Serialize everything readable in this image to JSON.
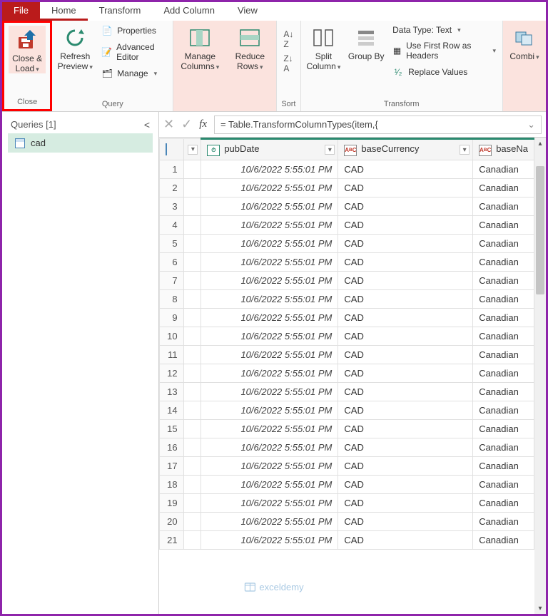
{
  "tabs": {
    "file": "File",
    "home": "Home",
    "transform": "Transform",
    "addColumn": "Add Column",
    "view": "View"
  },
  "ribbon": {
    "close": {
      "closeLoad": "Close & Load",
      "group": "Close"
    },
    "query": {
      "refresh": "Refresh Preview",
      "properties": "Properties",
      "advEditor": "Advanced Editor",
      "manage": "Manage",
      "group": "Query"
    },
    "cols": {
      "manageCols": "Manage Columns",
      "reduceRows": "Reduce Rows"
    },
    "sort": {
      "group": "Sort"
    },
    "split": "Split Column",
    "groupBy": "Group By",
    "dataType": "Data Type: Text",
    "firstRow": "Use First Row as Headers",
    "replace": "Replace Values",
    "transformGroup": "Transform",
    "combine": "Combi"
  },
  "queries": {
    "header": "Queries [1]",
    "item": "cad"
  },
  "formula": "= Table.TransformColumnTypes(item,{",
  "columns": {
    "pubDate": "pubDate",
    "baseCurrency": "baseCurrency",
    "baseName": "baseNa"
  },
  "rows": [
    {
      "n": 1,
      "d": "10/6/2022 5:55:01 PM",
      "c": "CAD",
      "b": "Canadian"
    },
    {
      "n": 2,
      "d": "10/6/2022 5:55:01 PM",
      "c": "CAD",
      "b": "Canadian"
    },
    {
      "n": 3,
      "d": "10/6/2022 5:55:01 PM",
      "c": "CAD",
      "b": "Canadian"
    },
    {
      "n": 4,
      "d": "10/6/2022 5:55:01 PM",
      "c": "CAD",
      "b": "Canadian"
    },
    {
      "n": 5,
      "d": "10/6/2022 5:55:01 PM",
      "c": "CAD",
      "b": "Canadian"
    },
    {
      "n": 6,
      "d": "10/6/2022 5:55:01 PM",
      "c": "CAD",
      "b": "Canadian"
    },
    {
      "n": 7,
      "d": "10/6/2022 5:55:01 PM",
      "c": "CAD",
      "b": "Canadian"
    },
    {
      "n": 8,
      "d": "10/6/2022 5:55:01 PM",
      "c": "CAD",
      "b": "Canadian"
    },
    {
      "n": 9,
      "d": "10/6/2022 5:55:01 PM",
      "c": "CAD",
      "b": "Canadian"
    },
    {
      "n": 10,
      "d": "10/6/2022 5:55:01 PM",
      "c": "CAD",
      "b": "Canadian"
    },
    {
      "n": 11,
      "d": "10/6/2022 5:55:01 PM",
      "c": "CAD",
      "b": "Canadian"
    },
    {
      "n": 12,
      "d": "10/6/2022 5:55:01 PM",
      "c": "CAD",
      "b": "Canadian"
    },
    {
      "n": 13,
      "d": "10/6/2022 5:55:01 PM",
      "c": "CAD",
      "b": "Canadian"
    },
    {
      "n": 14,
      "d": "10/6/2022 5:55:01 PM",
      "c": "CAD",
      "b": "Canadian"
    },
    {
      "n": 15,
      "d": "10/6/2022 5:55:01 PM",
      "c": "CAD",
      "b": "Canadian"
    },
    {
      "n": 16,
      "d": "10/6/2022 5:55:01 PM",
      "c": "CAD",
      "b": "Canadian"
    },
    {
      "n": 17,
      "d": "10/6/2022 5:55:01 PM",
      "c": "CAD",
      "b": "Canadian"
    },
    {
      "n": 18,
      "d": "10/6/2022 5:55:01 PM",
      "c": "CAD",
      "b": "Canadian"
    },
    {
      "n": 19,
      "d": "10/6/2022 5:55:01 PM",
      "c": "CAD",
      "b": "Canadian"
    },
    {
      "n": 20,
      "d": "10/6/2022 5:55:01 PM",
      "c": "CAD",
      "b": "Canadian"
    },
    {
      "n": 21,
      "d": "10/6/2022 5:55:01 PM",
      "c": "CAD",
      "b": "Canadian"
    }
  ],
  "watermark": "exceldemy"
}
